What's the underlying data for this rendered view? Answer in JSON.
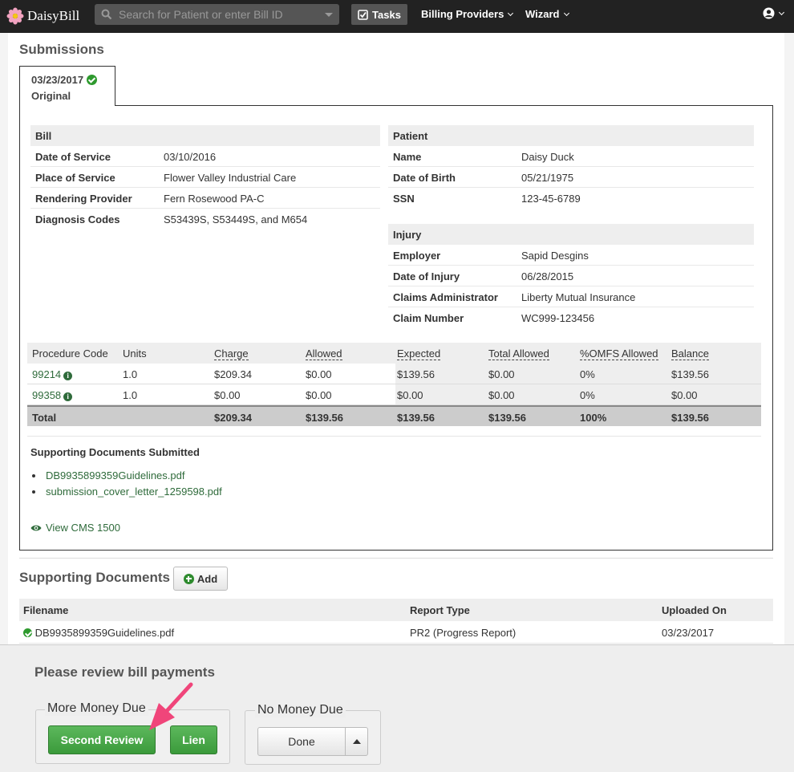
{
  "nav": {
    "brand": "DaisyBill",
    "search_placeholder": "Search for Patient or enter Bill ID",
    "tasks": "Tasks",
    "billing_providers": "Billing Providers",
    "wizard": "Wizard"
  },
  "submissions": {
    "title": "Submissions",
    "tab_date": "03/23/2017",
    "tab_label": "Original",
    "bill": {
      "heading": "Bill",
      "rows": [
        {
          "k": "Date of Service",
          "v": "03/10/2016"
        },
        {
          "k": "Place of Service",
          "v": "Flower Valley Industrial Care"
        },
        {
          "k": "Rendering Provider",
          "v": "Fern Rosewood PA-C"
        },
        {
          "k": "Diagnosis Codes",
          "v": "S53439S, S53449S, and M654"
        }
      ]
    },
    "patient": {
      "heading": "Patient",
      "rows": [
        {
          "k": "Name",
          "v": "Daisy Duck"
        },
        {
          "k": "Date of Birth",
          "v": "05/21/1975"
        },
        {
          "k": "SSN",
          "v": "123-45-6789"
        }
      ]
    },
    "injury": {
      "heading": "Injury",
      "rows": [
        {
          "k": "Employer",
          "v": "Sapid Desgins"
        },
        {
          "k": "Date of Injury",
          "v": "06/28/2015"
        },
        {
          "k": "Claims Administrator",
          "v": "Liberty Mutual Insurance"
        },
        {
          "k": "Claim Number",
          "v": "WC999-123456"
        }
      ]
    },
    "procedures": {
      "headers": [
        "Procedure Code",
        "Units",
        "Charge",
        "Allowed",
        "Expected",
        "Total Allowed",
        "%OMFS Allowed",
        "Balance"
      ],
      "rows": [
        [
          "99214",
          "1.0",
          "$209.34",
          "$0.00",
          "$139.56",
          "$0.00",
          "0%",
          "$139.56"
        ],
        [
          "99358",
          "1.0",
          "$0.00",
          "$0.00",
          "$0.00",
          "$0.00",
          "0%",
          "$0.00"
        ]
      ],
      "total": [
        "Total",
        "",
        "$209.34",
        "$139.56",
        "$139.56",
        "$139.56",
        "100%",
        "$139.56"
      ]
    },
    "supporting_title": "Supporting Documents Submitted",
    "supporting_files": [
      "DB9935899359Guidelines.pdf",
      "submission_cover_letter_1259598.pdf"
    ],
    "view_cms": "View CMS 1500"
  },
  "documents": {
    "title": "Supporting Documents",
    "add_label": "Add",
    "headers": [
      "Filename",
      "Report Type",
      "Uploaded On"
    ],
    "rows": [
      [
        "DB9935899359Guidelines.pdf",
        "PR2 (Progress Report)",
        "03/23/2017"
      ]
    ]
  },
  "review": {
    "title": "Please review bill payments",
    "more_money_legend": "More Money Due",
    "second_review": "Second Review",
    "lien": "Lien",
    "no_money_legend": "No Money Due",
    "done": "Done"
  },
  "colors": {
    "accent_green": "#3b9a3b",
    "link_green": "#2f6b3b",
    "arrow_pink": "#f0457a",
    "nav_bg": "#222222"
  }
}
